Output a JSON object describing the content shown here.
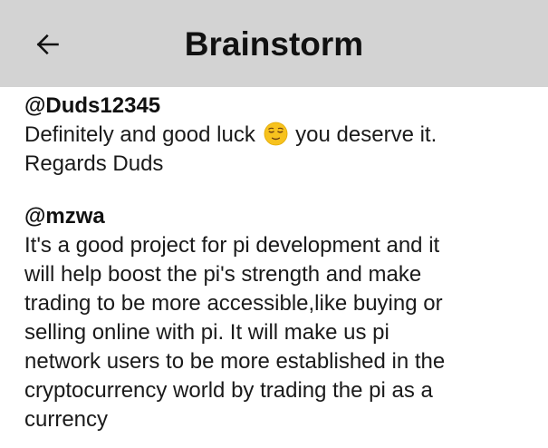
{
  "header": {
    "title": "Brainstorm",
    "back_icon": "arrow-left-icon"
  },
  "comments": [
    {
      "username": "@Duds12345",
      "lines": [
        {
          "before": "Definitely and good luck",
          "emoji": "relieved-face-icon",
          "after": "you deserve it."
        },
        {
          "text": "Regards Duds"
        }
      ]
    },
    {
      "username": "@mzwa",
      "lines": [
        {
          "text": "It's a good project for pi development and it"
        },
        {
          "text": "will help boost the pi's strength and make"
        },
        {
          "text": "trading to be more accessible,like buying or"
        },
        {
          "text": "selling online with pi. It will make us pi"
        },
        {
          "text": "network users to be more established in the"
        },
        {
          "text": "cryptocurrency world by trading the pi as a"
        },
        {
          "text": "currency"
        }
      ]
    }
  ],
  "colors": {
    "header_bg": "#d3d3d3",
    "text": "#1a1a1a",
    "emoji_face": "#f7c21e"
  }
}
